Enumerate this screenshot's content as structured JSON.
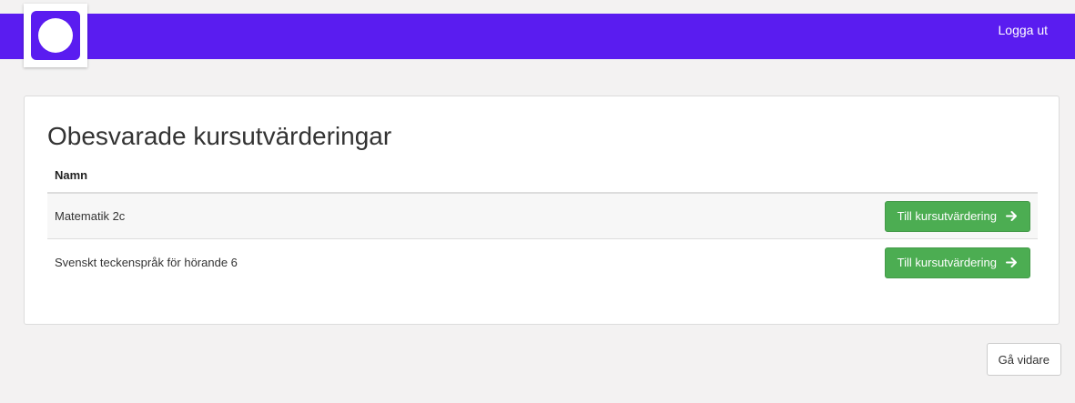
{
  "header": {
    "logout_label": "Logga ut"
  },
  "main": {
    "title": "Obesvarade kursutvärderingar",
    "table": {
      "column_name": "Namn",
      "rows": [
        {
          "name": "Matematik 2c",
          "action_label": "Till kursutvärdering"
        },
        {
          "name": "Svenskt teckenspråk för hörande 6",
          "action_label": "Till kursutvärdering"
        }
      ]
    }
  },
  "footer": {
    "next_label": "Gå vidare"
  },
  "colors": {
    "brand": "#5a1cf0",
    "success": "#4cad52"
  },
  "icons": {
    "logo": "circle-logo-icon",
    "action_arrow": "arrow-right-icon"
  }
}
